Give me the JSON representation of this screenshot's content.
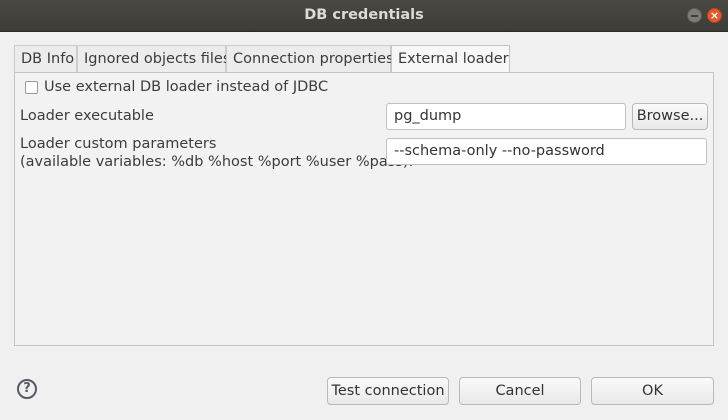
{
  "window": {
    "title": "DB credentials"
  },
  "tabs": [
    {
      "label": "DB Info",
      "active": false
    },
    {
      "label": "Ignored objects files",
      "active": false
    },
    {
      "label": "Connection properties",
      "active": false
    },
    {
      "label": "External loader",
      "active": true
    }
  ],
  "external_loader": {
    "use_external_label": "Use external DB loader instead of JDBC",
    "use_external_checked": false,
    "executable_label": "Loader executable",
    "executable_value": "pg_dump",
    "browse_label": "Browse...",
    "params_label_line1": "Loader custom parameters",
    "params_label_line2": "(available variables: %db %host %port %user %pass):",
    "params_value": "--schema-only --no-password"
  },
  "footer": {
    "help_symbol": "?",
    "test_connection_label": "Test connection",
    "cancel_label": "Cancel",
    "ok_label": "OK"
  }
}
